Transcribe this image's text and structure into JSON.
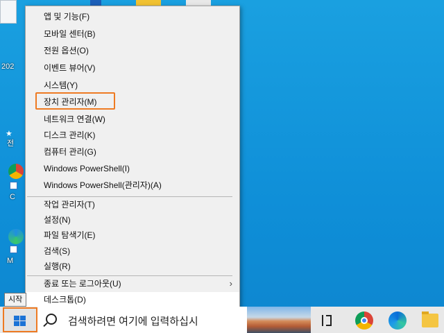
{
  "desktop": {
    "icons": [
      {
        "label": "202"
      },
      {
        "label": "전"
      },
      {
        "label": "C"
      },
      {
        "label": "M"
      }
    ]
  },
  "context_menu": {
    "items": [
      {
        "label": "앱 및 기능(F)"
      },
      {
        "label": "모바일 센터(B)"
      },
      {
        "label": "전원 옵션(O)"
      },
      {
        "label": "이벤트 뷰어(V)"
      },
      {
        "label": "시스템(Y)"
      },
      {
        "label": "장치 관리자(M)"
      },
      {
        "label": "네트워크 연결(W)"
      },
      {
        "label": "디스크 관리(K)"
      },
      {
        "label": "컴퓨터 관리(G)"
      },
      {
        "label": "Windows PowerShell(I)"
      },
      {
        "label": "Windows PowerShell(관리자)(A)"
      },
      {
        "label": "작업 관리자(T)"
      },
      {
        "label": "설정(N)"
      },
      {
        "label": "파일 탐색기(E)"
      },
      {
        "label": "검색(S)"
      },
      {
        "label": "실행(R)"
      },
      {
        "label": "종료 또는 로그아웃(U)"
      },
      {
        "label": "데스크톱(D)"
      }
    ],
    "highlight_color": "#ee7a22"
  },
  "taskbar": {
    "start_tooltip": "시작",
    "search_placeholder": "검색하려면 여기에 입력하십시"
  }
}
